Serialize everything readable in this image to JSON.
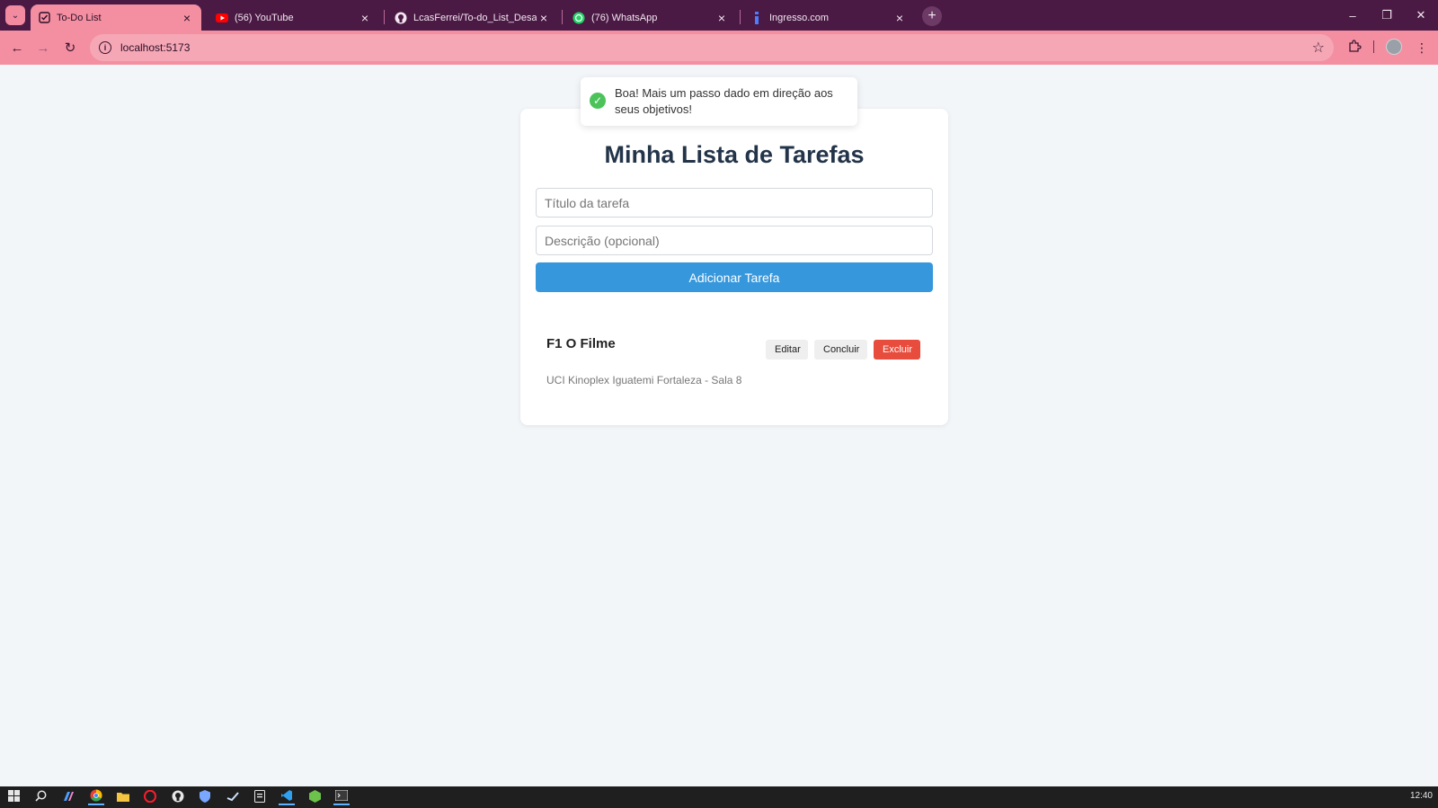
{
  "browser": {
    "tabs": [
      {
        "title": "To-Do List",
        "icon": "todo-favicon",
        "active": true
      },
      {
        "title": "(56) YouTube",
        "icon": "youtube-icon",
        "active": false
      },
      {
        "title": "LcasFerrei/To-do_List_Desafio: D",
        "icon": "github-icon",
        "active": false
      },
      {
        "title": "(76) WhatsApp",
        "icon": "whatsapp-icon",
        "active": false
      },
      {
        "title": "Ingresso.com",
        "icon": "ingresso-icon",
        "active": false
      }
    ],
    "url": "localhost:5173",
    "accent": "#f48fa1",
    "frame_color": "#4a1a45"
  },
  "toast": {
    "message": "Boa! Mais um passo dado em direção aos seus objetivos!"
  },
  "app": {
    "title": "Minha Lista de Tarefas",
    "title_placeholder": "Título da tarefa",
    "description_placeholder": "Descrição (opcional)",
    "add_button": "Adicionar Tarefa",
    "tasks": [
      {
        "title": "F1 O Filme",
        "description": "UCI Kinoplex Iguatemi Fortaleza - Sala 8",
        "edit_label": "Editar",
        "complete_label": "Concluir",
        "delete_label": "Excluir"
      }
    ]
  },
  "taskbar": {
    "time": "12:40"
  }
}
